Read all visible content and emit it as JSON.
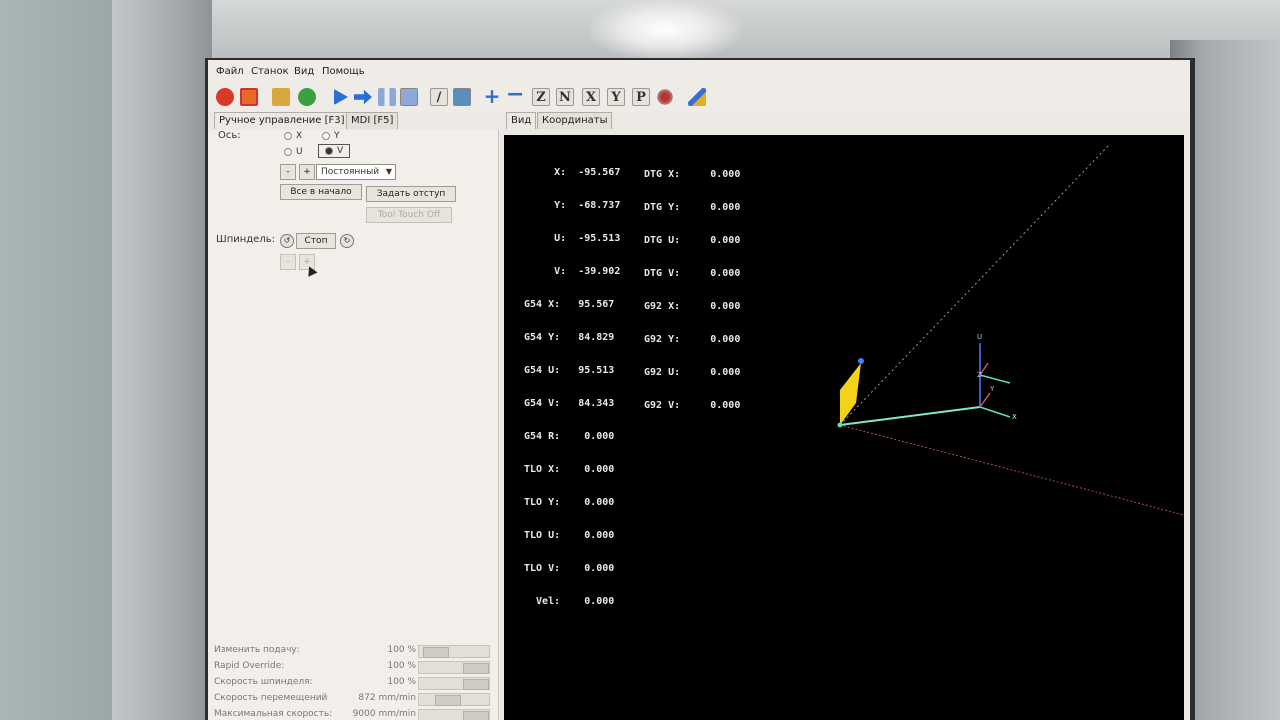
{
  "menu": {
    "file": "Файл",
    "machine": "Станок",
    "view": "Вид",
    "help": "Помощь"
  },
  "toolbar": {
    "icons": [
      "estop-icon",
      "power-icon",
      "open-folder-icon",
      "reload-icon",
      "run-icon",
      "step-icon",
      "pause-icon",
      "stop-icon",
      "block-delete-icon",
      "optional-stop-icon",
      "zoom-in-icon",
      "zoom-out-icon",
      "view-z-icon",
      "view-z2-icon",
      "view-x-icon",
      "view-y-icon",
      "view-p-icon",
      "rotate-view-icon",
      "clear-plot-icon"
    ],
    "view_z": "Z",
    "view_z2": "N",
    "view_x": "X",
    "view_y": "Y",
    "view_p": "P"
  },
  "left_tabs": {
    "manual": "Ручное управление [F3]",
    "mdi": "MDI [F5]"
  },
  "right_tabs": {
    "view": "Вид",
    "coords": "Координаты"
  },
  "manual": {
    "axis_label": "Ось:",
    "axes": [
      {
        "label": "X",
        "selected": false
      },
      {
        "label": "Y",
        "selected": false
      },
      {
        "label": "U",
        "selected": false
      },
      {
        "label": "V",
        "selected": true
      }
    ],
    "minus": "-",
    "plus": "+",
    "jog_mode": "Постоянный",
    "home_all": "Все в начало",
    "touch_off": "Задать отступ",
    "tool_touch_off": "Tool Touch Off",
    "spindle_label": "Шпиндель:",
    "spindle_stop": "Стоп",
    "spindle_minus": "-",
    "spindle_plus": "+"
  },
  "sliders": [
    {
      "name": "Изменить подачу:",
      "value": "100 %"
    },
    {
      "name": "Rapid Override:",
      "value": "100 %"
    },
    {
      "name": "Скорость шпинделя:",
      "value": "100 %"
    },
    {
      "name": "Скорость перемещений",
      "value": "872 mm/min"
    },
    {
      "name": "Максимальная скорость:",
      "value": "9000 mm/min"
    }
  ],
  "dro_left": [
    {
      "label": "     X:",
      "value": "-95.567"
    },
    {
      "label": "     Y:",
      "value": "-68.737"
    },
    {
      "label": "     U:",
      "value": "-95.513"
    },
    {
      "label": "     V:",
      "value": "-39.902"
    },
    {
      "label": "G54 X:",
      "value": "95.567"
    },
    {
      "label": "G54 Y:",
      "value": "84.829"
    },
    {
      "label": "G54 U:",
      "value": "95.513"
    },
    {
      "label": "G54 V:",
      "value": "84.343"
    },
    {
      "label": "G54 R:",
      "value": "0.000"
    },
    {
      "label": "TLO X:",
      "value": "0.000"
    },
    {
      "label": "TLO Y:",
      "value": "0.000"
    },
    {
      "label": "TLO U:",
      "value": "0.000"
    },
    {
      "label": "TLO V:",
      "value": "0.000"
    },
    {
      "label": "  Vel:",
      "value": "0.000"
    }
  ],
  "dro_right": [
    {
      "label": "DTG X:",
      "value": "0.000"
    },
    {
      "label": "DTG Y:",
      "value": "0.000"
    },
    {
      "label": "DTG U:",
      "value": "0.000"
    },
    {
      "label": "DTG V:",
      "value": "0.000"
    },
    {
      "label": "G92 X:",
      "value": "0.000"
    },
    {
      "label": "G92 Y:",
      "value": "0.000"
    },
    {
      "label": "G92 U:",
      "value": "0.000"
    },
    {
      "label": "G92 V:",
      "value": "0.000"
    }
  ],
  "colors": {
    "tool": "#f2d31a",
    "axis_x": "#55e0c0",
    "axis_y": "#e05050",
    "axis_z": "#4a7cff",
    "limit_dots": "#aaaaaa",
    "rapid_path": "#b05050"
  },
  "axis_labels": {
    "u": "U",
    "x": "X",
    "y": "Y",
    "z": "Z"
  }
}
